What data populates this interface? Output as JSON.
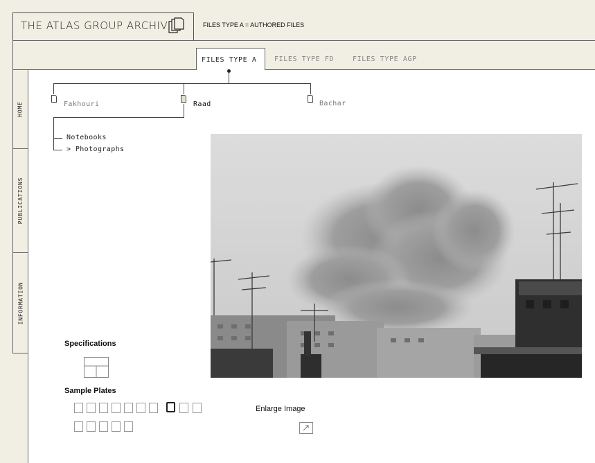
{
  "header": {
    "title": "THE ATLAS GROUP ARCHIVE",
    "subtitle": "FILES TYPE A = AUTHORED FILES"
  },
  "tabs": [
    {
      "label": "FILES TYPE A",
      "active": true
    },
    {
      "label": "FILES TYPE FD",
      "active": false
    },
    {
      "label": "FILES TYPE AGP",
      "active": false
    }
  ],
  "sidebar": {
    "items": [
      {
        "label": "HOME"
      },
      {
        "label": "PUBLICATIONS"
      },
      {
        "label": "INFORMATION"
      }
    ]
  },
  "tree": {
    "authors": [
      {
        "label": "Fakhouri",
        "selected": false
      },
      {
        "label": "Raad",
        "selected": true
      },
      {
        "label": "Bachar",
        "selected": false
      }
    ],
    "sub_items": [
      {
        "label": "Notebooks"
      },
      {
        "label": "> Photographs"
      }
    ]
  },
  "specifications": {
    "heading": "Specifications"
  },
  "sample_plates": {
    "heading": "Sample Plates",
    "total": 14,
    "active_index": 6
  },
  "enlarge": {
    "label": "Enlarge Image"
  },
  "colors": {
    "background": "#f1eee3",
    "content": "#ffffff",
    "border": "#666666"
  }
}
